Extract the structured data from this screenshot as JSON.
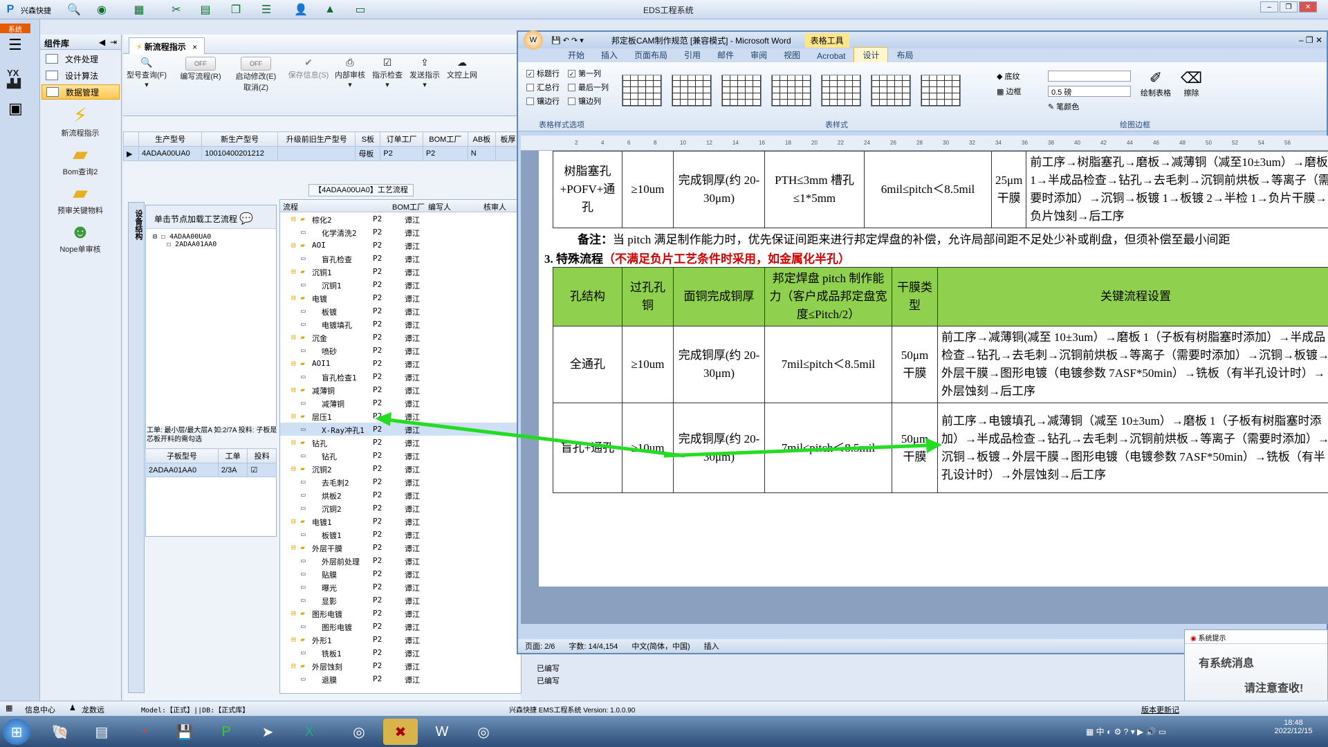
{
  "app": {
    "title": "EDS工程系统",
    "menu_label": "兴森快捷"
  },
  "sidebar": {
    "system_label": "系统",
    "component_label": "组件库",
    "items": [
      {
        "label": "文件处理"
      },
      {
        "label": "设计算法"
      },
      {
        "label": "数据管理"
      }
    ],
    "tools": [
      {
        "label": "新流程指示"
      },
      {
        "label": "Bom查询2"
      },
      {
        "label": "预审关键物料"
      },
      {
        "label": "Nope单审核"
      }
    ]
  },
  "tab": {
    "label": "新流程指示"
  },
  "ribbon": {
    "items": [
      {
        "label": "型号查询(F)"
      },
      {
        "label": "编写流程(R)"
      },
      {
        "label": "启动修改(E)"
      },
      {
        "label": "保存信息(S)"
      },
      {
        "label": "内部审核"
      },
      {
        "label": "指示检查"
      },
      {
        "label": "发送指示"
      },
      {
        "label": "文控上网"
      }
    ],
    "toggle_off": "OFF",
    "cancel_label": "取消(Z)"
  },
  "product_table": {
    "headers": [
      "生产型号",
      "新生产型号",
      "升级前旧生产型号",
      "S板",
      "订单工厂",
      "BOM工厂",
      "AB板",
      "板厚"
    ],
    "row": [
      "4ADAA00UA0",
      "10010400201212",
      "",
      "母板",
      "P2",
      "P2",
      "N",
      ""
    ]
  },
  "process_panel": {
    "title": "【4ADAA00UA0】工艺流程",
    "tree_hint": "单击节点加载工艺流程",
    "vertical_tab": "设备结构",
    "tree": [
      "4ADAA00UA0",
      "2ADAA01AA0"
    ],
    "info": "工单: 最小层/最大层A 如:2/7A 投料: 子板是芯板开料的需勾选",
    "sub_headers": [
      "子板型号",
      "工单",
      "投料"
    ],
    "sub_row": [
      "2ADAA01AA0",
      "2/3A",
      ""
    ],
    "headers": [
      "流程",
      "BOM工厂",
      "编写人",
      "核审人"
    ],
    "rows": [
      [
        "棕化2",
        "P2",
        "谭江"
      ],
      [
        "化学清洗2",
        "P2",
        "谭江"
      ],
      [
        "AOI",
        "P2",
        "谭江"
      ],
      [
        "盲孔检查",
        "P2",
        "谭江"
      ],
      [
        "沉铜1",
        "P2",
        "谭江"
      ],
      [
        "沉铜1",
        "P2",
        "谭江"
      ],
      [
        "电镀",
        "P2",
        "谭江"
      ],
      [
        "板镀",
        "P2",
        "谭江"
      ],
      [
        "电镀填孔",
        "P2",
        "谭江"
      ],
      [
        "沉金",
        "P2",
        "谭江"
      ],
      [
        "喷砂",
        "P2",
        "谭江"
      ],
      [
        "AOI1",
        "P2",
        "谭江"
      ],
      [
        "盲孔检查1",
        "P2",
        "谭江"
      ],
      [
        "减薄铜",
        "P2",
        "谭江"
      ],
      [
        "减薄铜",
        "P2",
        "谭江"
      ],
      [
        "层压1",
        "P2",
        "谭江"
      ],
      [
        "X-Ray冲孔1",
        "P2",
        "谭江"
      ],
      [
        "钻孔",
        "P2",
        "谭江"
      ],
      [
        "钻孔",
        "P2",
        "谭江"
      ],
      [
        "沉铜2",
        "P2",
        "谭江"
      ],
      [
        "去毛刺2",
        "P2",
        "谭江"
      ],
      [
        "烘板2",
        "P2",
        "谭江"
      ],
      [
        "沉铜2",
        "P2",
        "谭江"
      ],
      [
        "电镀1",
        "P2",
        "谭江"
      ],
      [
        "板镀1",
        "P2",
        "谭江"
      ],
      [
        "外层干膜",
        "P2",
        "谭江"
      ],
      [
        "外层前处理",
        "P2",
        "谭江"
      ],
      [
        "贴膜",
        "P2",
        "谭江"
      ],
      [
        "曝光",
        "P2",
        "谭江"
      ],
      [
        "显影",
        "P2",
        "谭江"
      ],
      [
        "图形电镀",
        "P2",
        "谭江"
      ],
      [
        "图形电镀",
        "P2",
        "谭江"
      ],
      [
        "外形1",
        "P2",
        "谭江"
      ],
      [
        "铣板1",
        "P2",
        "谭江"
      ],
      [
        "外层蚀刻",
        "P2",
        "谭江"
      ],
      [
        "退膜",
        "P2",
        "谭江"
      ]
    ],
    "tail": [
      "已编写",
      "已编写"
    ]
  },
  "word": {
    "title": "邦定板CAM制作规范 [兼容模式] - Microsoft Word",
    "tool_title": "表格工具",
    "tabs": [
      "开始",
      "插入",
      "页面布局",
      "引用",
      "邮件",
      "审阅",
      "视图",
      "Acrobat",
      "设计",
      "布局"
    ],
    "checks": [
      "标题行",
      "第一列",
      "汇总行",
      "最后一列",
      "镶边行",
      "镶边列"
    ],
    "groups": [
      "表格样式选项",
      "表样式",
      "绘图边框"
    ],
    "ribbon_labels": {
      "shading": "底纹",
      "border": "边框",
      "pen_weight": "0.5 磅",
      "pen_color": "笔颜色",
      "draw": "绘制表格",
      "erase": "擦除"
    },
    "row_top": [
      "树脂塞孔+POFV+通孔",
      "≥10um",
      "完成铜厚(约 20-30μm)",
      "PTH≤3mm 槽孔≤1*5mm",
      "6mil≤pitch＜8.5mil",
      "25μm干膜",
      "前工序→树脂塞孔→磨板→减薄铜（减至10±3um）→磨板 1→半成品检查→钻孔→去毛刺→沉铜前烘板→等离子（需要时添加）→沉铜→板镀 1→板镀 2→半检 1→负片干膜→负片蚀刻→后工序"
    ],
    "note_label": "备注：",
    "note": "当 pitch 满足制作能力时，优先保证间距来进行邦定焊盘的补偿，允许局部间距不足处少补或削盘，但须补偿至最小间距",
    "section_num": "3.",
    "section_title": "特殊流程",
    "section_red": "（不满足负片工艺条件时采用，如金属化半孔）",
    "headers": [
      "孔结构",
      "过孔孔铜",
      "面铜完成铜厚",
      "邦定焊盘 pitch 制作能力（客户成品邦定盘宽度≤Pitch/2）",
      "干膜类型",
      "关键流程设置"
    ],
    "rows": [
      [
        "全通孔",
        "≥10um",
        "完成铜厚(约 20-30μm)",
        "7mil≤pitch＜8.5mil",
        "50μm干膜",
        "前工序→减薄铜(减至 10±3um）→磨板 1（子板有树脂塞时添加）→半成品检查→钻孔→去毛刺→沉铜前烘板→等离子（需要时添加）→沉铜→板镀→外层干膜→图形电镀（电镀参数 7ASF*50min）→铣板（有半孔设计时）→外层蚀刻→后工序"
      ],
      [
        "盲孔+通孔",
        "≥10um",
        "完成铜厚(约 20-30μm)",
        "7mil≤pitch＜8.5mil",
        "50μm干膜",
        "前工序→电镀填孔→减薄铜（减至 10±3um）→磨板 1（子板有树脂塞时添加）→半成品检查→钻孔→去毛刺→沉铜前烘板→等离子（需要时添加）→沉铜→板镀→外层干膜→图形电镀（电镀参数 7ASF*50min）→铣板（有半孔设计时）→外层蚀刻→后工序"
      ]
    ],
    "status": [
      "页面: 2/6",
      "字数: 14/4,154",
      "中文(简体，中国)",
      "插入"
    ]
  },
  "statusbar": {
    "info_center": "信息中心",
    "user": "龙数远",
    "model": "Model:【正式】||DB:【正式库】",
    "version": "兴森快捷 EMS工程系统 Version: 1.0.0.90",
    "update": "版本更新记"
  },
  "notification": {
    "title": "系统提示",
    "line1": "有系统消息",
    "line2": "请注意查收!"
  },
  "clock": {
    "time": "18:48",
    "date": "2022/12/15"
  },
  "colors": {
    "accent": "#8fd14f",
    "red": "#d00000",
    "arrow": "#22dd22"
  }
}
